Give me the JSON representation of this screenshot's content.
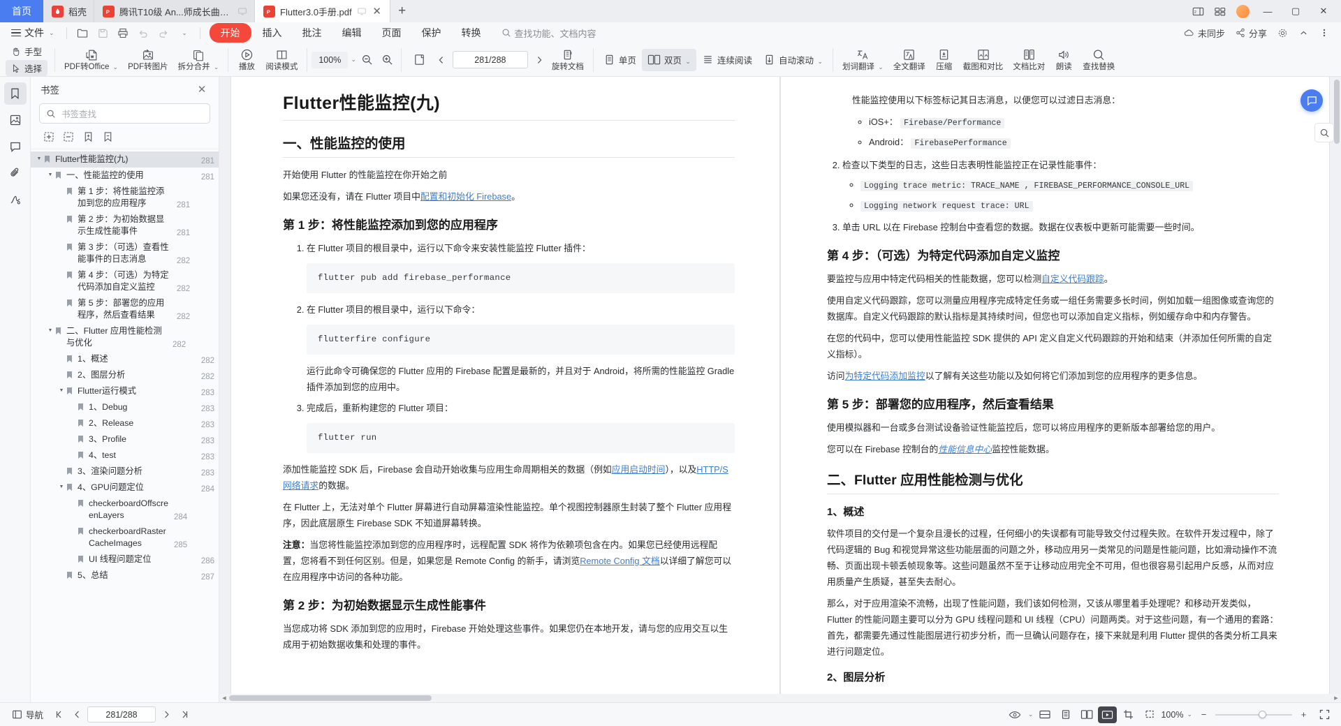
{
  "window": {
    "tabs": [
      {
        "label": "首页",
        "type": "home"
      },
      {
        "label": "稻壳",
        "type": "docer",
        "icon": "docer-icon"
      },
      {
        "label": "腾讯T10级 An...师成长曲线.pdf",
        "type": "pdf",
        "icon": "pdf-icon",
        "active": false
      },
      {
        "label": "Flutter3.0手册.pdf",
        "type": "pdf",
        "icon": "pdf-icon",
        "active": true
      }
    ],
    "new_tab_label": "+",
    "right_icons": [
      "split-view-icon",
      "grid-view-icon",
      "avatar"
    ],
    "controls": {
      "minimize": "—",
      "maximize": "▢",
      "close": "✕"
    }
  },
  "menu": {
    "file_label": "文件",
    "quick_actions": [
      "open-icon",
      "save-icon",
      "print-icon",
      "undo-icon",
      "redo-icon",
      "more-icon"
    ],
    "ribbon_tabs": [
      {
        "label": "开始",
        "active": true
      },
      {
        "label": "插入",
        "active": false
      },
      {
        "label": "批注",
        "active": false
      },
      {
        "label": "编辑",
        "active": false
      },
      {
        "label": "页面",
        "active": false
      },
      {
        "label": "保护",
        "active": false
      },
      {
        "label": "转换",
        "active": false
      }
    ],
    "search_placeholder": "查找功能、文档内容",
    "right_items": [
      {
        "label": "未同步",
        "icon": "sync-icon"
      },
      {
        "label": "分享",
        "icon": "share-icon"
      },
      {
        "label": "",
        "icon": "settings-icon"
      },
      {
        "label": "",
        "icon": "collapse-icon"
      },
      {
        "label": "",
        "icon": "more-vertical-icon"
      }
    ]
  },
  "toolbar": {
    "hand_label": "手型",
    "select_label": "选择",
    "items": [
      {
        "label": "PDF转Office",
        "icon": "pdf-to-office-icon",
        "dropdown": true
      },
      {
        "label": "PDF转图片",
        "icon": "pdf-to-image-icon",
        "dropdown": false
      },
      {
        "label": "拆分合并",
        "icon": "split-merge-icon",
        "dropdown": true
      },
      {
        "label": "播放",
        "icon": "play-icon",
        "dropdown": false
      },
      {
        "label": "阅读模式",
        "icon": "reading-mode-icon",
        "dropdown": false
      }
    ],
    "zoom_value": "100%",
    "zoom_out_icon": "zoom-out-icon",
    "zoom_in_icon": "zoom-in-icon",
    "rotate_label": "旋转文档",
    "page_field": "281/288",
    "page_prev_icon": "chevron-left-icon",
    "page_next_icon": "chevron-right-icon",
    "fit_items": [
      {
        "label": "单页",
        "icon": "single-page-icon"
      },
      {
        "label": "双页",
        "icon": "dual-page-icon",
        "dropdown": true
      },
      {
        "label": "连续阅读",
        "icon": "continuous-icon"
      },
      {
        "label": "自动滚动",
        "icon": "auto-scroll-icon",
        "dropdown": true
      }
    ],
    "right_items": [
      {
        "label": "划词翻译",
        "icon": "translate-word-icon",
        "dropdown": true
      },
      {
        "label": "全文翻译",
        "icon": "translate-all-icon"
      },
      {
        "label": "压缩",
        "icon": "compress-icon"
      },
      {
        "label": "截图和对比",
        "icon": "screenshot-compare-icon"
      },
      {
        "label": "文档比对",
        "icon": "doc-compare-icon"
      },
      {
        "label": "朗读",
        "icon": "read-aloud-icon"
      },
      {
        "label": "查找替换",
        "icon": "find-replace-icon"
      }
    ]
  },
  "rail": [
    {
      "name": "bookmark-icon",
      "active": true
    },
    {
      "name": "thumbnail-icon",
      "active": false
    },
    {
      "name": "comment-icon",
      "active": false
    },
    {
      "name": "attachment-icon",
      "active": false
    },
    {
      "name": "signature-icon",
      "active": false
    }
  ],
  "bookmarks": {
    "title": "书签",
    "search_placeholder": "书签查找",
    "tools": [
      "add-bookmark-icon",
      "remove-bookmark-icon",
      "import-bookmark-icon",
      "export-bookmark-icon"
    ],
    "items": [
      {
        "label": "Flutter性能监控(九)",
        "page": "281",
        "level": 0,
        "arrow": true,
        "selected": true
      },
      {
        "label": "一、性能监控的使用",
        "page": "281",
        "level": 1,
        "arrow": true
      },
      {
        "label": "第 1 步：将性能监控添加到您的应用程序",
        "page": "281",
        "level": 2
      },
      {
        "label": "第 2 步：为初始数据显示生成性能事件",
        "page": "281",
        "level": 2
      },
      {
        "label": "第 3 步：（可选）查看性能事件的日志消息",
        "page": "282",
        "level": 2
      },
      {
        "label": "第 4 步：（可选）为特定代码添加自定义监控",
        "page": "282",
        "level": 2
      },
      {
        "label": "第 5 步：部署您的应用程序，然后查看结果",
        "page": "282",
        "level": 2
      },
      {
        "label": "二、Flutter 应用性能检测与优化",
        "page": "282",
        "level": 1,
        "arrow": true
      },
      {
        "label": "1、概述",
        "page": "282",
        "level": 2
      },
      {
        "label": "2、图层分析",
        "page": "282",
        "level": 2
      },
      {
        "label": "Flutter运行模式",
        "page": "283",
        "level": 2,
        "arrow": true
      },
      {
        "label": "1、Debug",
        "page": "283",
        "level": 3
      },
      {
        "label": "2、Release",
        "page": "283",
        "level": 3
      },
      {
        "label": "3、Profile",
        "page": "283",
        "level": 3
      },
      {
        "label": "4、test",
        "page": "283",
        "level": 3
      },
      {
        "label": "3、渲染问题分析",
        "page": "283",
        "level": 2
      },
      {
        "label": "4、GPU问题定位",
        "page": "284",
        "level": 2,
        "arrow": true
      },
      {
        "label": "checkerboardOffscreenLayers",
        "page": "284",
        "level": 3
      },
      {
        "label": "checkerboardRasterCacheImages",
        "page": "285",
        "level": 3
      },
      {
        "label": "UI 线程问题定位",
        "page": "286",
        "level": 3
      },
      {
        "label": "5、总结",
        "page": "287",
        "level": 2
      }
    ]
  },
  "document": {
    "left_page": {
      "h1": "Flutter性能监控(九)",
      "h2": "一、性能监控的使用",
      "p1": "开始使用 Flutter 的性能监控在你开始之前",
      "p2_pre": "如果您还没有，请在 Flutter 项目中",
      "p2_link": "配置和初始化 Firebase",
      "p2_post": "。",
      "h3_step1": "第 1 步：将性能监控添加到您的应用程序",
      "li1": "在 Flutter 项目的根目录中，运行以下命令来安装性能监控 Flutter 插件：",
      "code1": "flutter pub add firebase_performance",
      "li2": "在 Flutter 项目的根目录中，运行以下命令：",
      "code2": "flutterfire configure",
      "li2_note": "运行此命令可确保您的 Flutter 应用的 Firebase 配置是最新的，并且对于 Android，将所需的性能监控 Gradle 插件添加到您的应用中。",
      "li3": "完成后，重新构建您的 Flutter 项目：",
      "code3": "flutter run",
      "p3_pre": "添加性能监控 SDK 后，Firebase 会自动开始收集与应用生命周期相关的数据（例如",
      "p3_link1": "应用启动时间",
      "p3_mid": "），以及",
      "p3_link2": "HTTP/S 网络请求",
      "p3_post": "的数据。",
      "p4": "在 Flutter 上，无法对单个 Flutter 屏幕进行自动屏幕渲染性能监控。单个视图控制器原生封装了整个 Flutter 应用程序，因此底层原生 Firebase SDK 不知道屏幕转换。",
      "p5_bold": "注意：",
      "p5_pre": "当您将性能监控添加到您的应用程序时，远程配置 SDK 将作为依赖项包含在内。如果您已经使用远程配置，您将看不到任何区别。但是，如果您是 Remote Config 的新手，请浏览",
      "p5_link": "Remote Config 文档",
      "p5_post": "以详细了解您可以在应用程序中访问的各种功能。",
      "h3_step2": "第 2 步：为初始数据显示生成性能事件",
      "p6": "当您成功将 SDK 添加到您的应用时，Firebase 开始处理这些事件。如果您仍在本地开发，请与您的应用交互以生成用于初始数据收集和处理的事件。"
    },
    "right_page": {
      "p_top": "性能监控使用以下标签标记其日志消息，以便您可以过滤日志消息：",
      "bullet1_label": "iOS+：",
      "bullet1_code": "Firebase/Performance",
      "bullet2_label": "Android：",
      "bullet2_code": "FirebasePerformance",
      "li2": "检查以下类型的日志，这些日志表明性能监控正在记录性能事件：",
      "li2_code1": "Logging trace metric: TRACE_NAME , FIREBASE_PERFORMANCE_CONSOLE_URL",
      "li2_code2": "Logging network request trace: URL",
      "li3": "单击 URL 以在 Firebase 控制台中查看您的数据。数据在仪表板中更新可能需要一些时间。",
      "h3_step4": "第 4 步：（可选）为特定代码添加自定义监控",
      "p1_pre": "要监控与应用中特定代码相关的性能数据，您可以检测",
      "p1_link": "自定义代码跟踪",
      "p1_post": "。",
      "p2": "使用自定义代码跟踪，您可以测量应用程序完成特定任务或一组任务需要多长时间，例如加载一组图像或查询您的数据库。自定义代码跟踪的默认指标是其持续时间，但您也可以添加自定义指标，例如缓存命中和内存警告。",
      "p3": "在您的代码中，您可以使用性能监控 SDK 提供的 API 定义自定义代码跟踪的开始和结束（并添加任何所需的自定义指标）。",
      "p4_pre": "访问",
      "p4_link": "为特定代码添加监控",
      "p4_post": "以了解有关这些功能以及如何将它们添加到您的应用程序的更多信息。",
      "h3_step5": "第 5 步：部署您的应用程序，然后查看结果",
      "p5": "使用模拟器和一台或多台测试设备验证性能监控后，您可以将应用程序的更新版本部署给您的用户。",
      "p6_pre": "您可以在 Firebase 控制台的",
      "p6_link": "性能信息中心",
      "p6_post": "监控性能数据。",
      "h2": "二、Flutter 应用性能检测与优化",
      "h3_overview": "1、概述",
      "p7": "软件项目的交付是一个复杂且漫长的过程，任何细小的失误都有可能导致交付过程失败。在软件开发过程中，除了代码逻辑的 Bug 和视觉异常这些功能层面的问题之外，移动应用另一类常见的问题是性能问题，比如滑动操作不流畅、页面出现卡顿丢帧现象等。这些问题虽然不至于让移动应用完全不可用，但也很容易引起用户反感，从而对应用质量产生质疑，甚至失去耐心。",
      "p8": "那么，对于应用渲染不流畅，出现了性能问题，我们该如何检测，又该从哪里着手处理呢？和移动开发类似，Flutter 的性能问题主要可以分为 GPU 线程问题和 UI 线程（CPU）问题两类。对于这些问题，有一个通用的套路：首先，都需要先通过性能图层进行初步分析，而一旦确认问题存在，接下来就是利用 Flutter 提供的各类分析工具来进行问题定位。",
      "h3_layer": "2、图层分析"
    }
  },
  "status": {
    "nav_label": "导航",
    "page_field": "281/288",
    "zoom_value": "100%",
    "left_icons": [
      "nav-icon",
      "first-page-icon",
      "prev-page-icon",
      "next-page-icon",
      "last-page-icon"
    ],
    "right_icons": [
      "eye-icon",
      "fit-width-icon",
      "single-page-icon",
      "dual-page-icon",
      "play-icon",
      "crop-icon",
      "lasso-icon",
      "full-screen-icon"
    ],
    "zoom_minus": "−",
    "zoom_plus": "+"
  }
}
